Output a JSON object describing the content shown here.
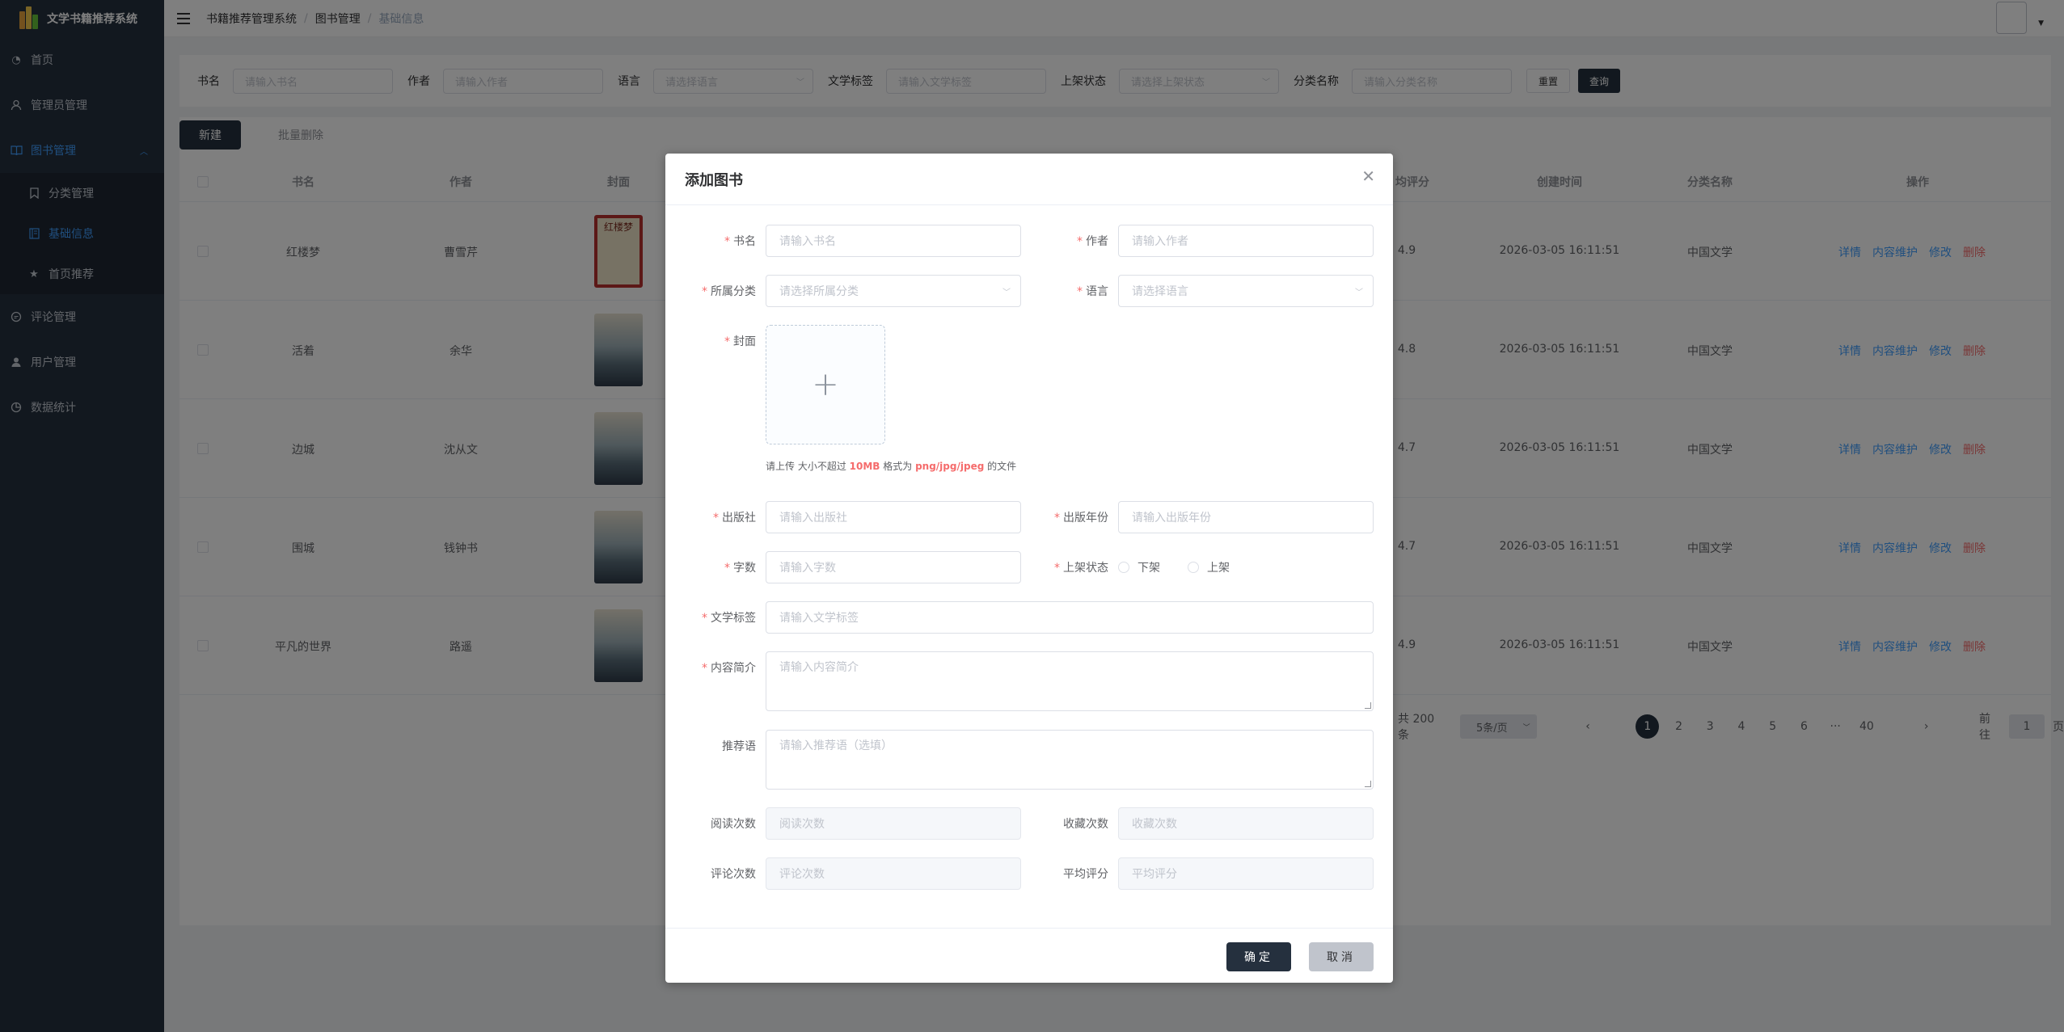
{
  "app": {
    "title": "文学书籍推荐系统"
  },
  "sidebar": {
    "items": [
      {
        "label": "首页",
        "icon": "dashboard-icon"
      },
      {
        "label": "管理员管理",
        "icon": "user-icon"
      },
      {
        "label": "图书管理",
        "icon": "book-icon"
      },
      {
        "label": "分类管理",
        "icon": "bookmark-icon"
      },
      {
        "label": "基础信息",
        "icon": "document-icon"
      },
      {
        "label": "首页推荐",
        "icon": "star-icon"
      },
      {
        "label": "评论管理",
        "icon": "comment-icon"
      },
      {
        "label": "用户管理",
        "icon": "person-icon"
      },
      {
        "label": "数据统计",
        "icon": "chart-icon"
      }
    ]
  },
  "header": {
    "breadcrumb": [
      "书籍推荐管理系统",
      "图书管理",
      "基础信息"
    ]
  },
  "search": {
    "fields": [
      {
        "label": "书名",
        "placeholder": "请输入书名"
      },
      {
        "label": "作者",
        "placeholder": "请输入作者"
      },
      {
        "label": "语言",
        "placeholder": "请选择语言"
      },
      {
        "label": "文学标签",
        "placeholder": "请输入文学标签"
      },
      {
        "label": "上架状态",
        "placeholder": "请选择上架状态"
      },
      {
        "label": "分类名称",
        "placeholder": "请输入分类名称"
      }
    ],
    "reset_label": "重置",
    "query_label": "查询"
  },
  "toolbar": {
    "new_label": "新建",
    "batch_delete_label": "批量删除"
  },
  "table": {
    "headers": [
      "书名",
      "作者",
      "封面",
      "均评分",
      "创建时间",
      "分类名称",
      "操作"
    ],
    "rows": [
      {
        "title": "红楼梦",
        "author": "曹雪芹",
        "cover_text": "红楼梦",
        "rating": "4.9",
        "created": "2026-03-05 16:11:51",
        "category": "中国文学"
      },
      {
        "title": "活着",
        "author": "余华",
        "rating": "4.8",
        "created": "2026-03-05 16:11:51",
        "category": "中国文学"
      },
      {
        "title": "边城",
        "author": "沈从文",
        "rating": "4.7",
        "created": "2026-03-05 16:11:51",
        "category": "中国文学"
      },
      {
        "title": "围城",
        "author": "钱钟书",
        "rating": "4.7",
        "created": "2026-03-05 16:11:51",
        "category": "中国文学"
      },
      {
        "title": "平凡的世界",
        "author": "路遥",
        "rating": "4.9",
        "created": "2026-03-05 16:11:51",
        "category": "中国文学"
      }
    ],
    "ops": {
      "detail": "详情",
      "content": "内容维护",
      "edit": "修改",
      "delete": "删除"
    }
  },
  "pagination": {
    "total": "共 200 条",
    "page_size": "5条/页",
    "pages": [
      "1",
      "2",
      "3",
      "4",
      "5",
      "6",
      "···",
      "40"
    ],
    "current": "1",
    "goto_label": "前往",
    "goto_value": "1",
    "page_unit": "页"
  },
  "dialog": {
    "title": "添加图书",
    "fields": {
      "title": {
        "label": "书名",
        "placeholder": "请输入书名"
      },
      "author": {
        "label": "作者",
        "placeholder": "请输入作者"
      },
      "category": {
        "label": "所属分类",
        "placeholder": "请选择所属分类"
      },
      "language": {
        "label": "语言",
        "placeholder": "请选择语言"
      },
      "cover": {
        "label": "封面"
      },
      "publisher": {
        "label": "出版社",
        "placeholder": "请输入出版社"
      },
      "year": {
        "label": "出版年份",
        "placeholder": "请输入出版年份"
      },
      "words": {
        "label": "字数",
        "placeholder": "请输入字数"
      },
      "status": {
        "label": "上架状态",
        "options": [
          "下架",
          "上架"
        ]
      },
      "tags": {
        "label": "文学标签",
        "placeholder": "请输入文学标签"
      },
      "summary": {
        "label": "内容简介",
        "placeholder": "请输入内容简介"
      },
      "recommend": {
        "label": "推荐语",
        "placeholder": "请输入推荐语（选填）"
      },
      "reads": {
        "label": "阅读次数",
        "placeholder": "阅读次数"
      },
      "favs": {
        "label": "收藏次数",
        "placeholder": "收藏次数"
      },
      "comments": {
        "label": "评论次数",
        "placeholder": "评论次数"
      },
      "avg": {
        "label": "平均评分",
        "placeholder": "平均评分"
      }
    },
    "upload_tip": {
      "prefix": "请上传 大小不超过 ",
      "size": "10MB",
      "middle": " 格式为 ",
      "formats": "png/jpg/jpeg",
      "suffix": " 的文件"
    },
    "ok_label": "确定",
    "cancel_label": "取消"
  },
  "colors": {
    "sidebar": "#25303e",
    "accent": "#409eff",
    "danger": "#f56c6c",
    "primary_button": "#25303e"
  }
}
